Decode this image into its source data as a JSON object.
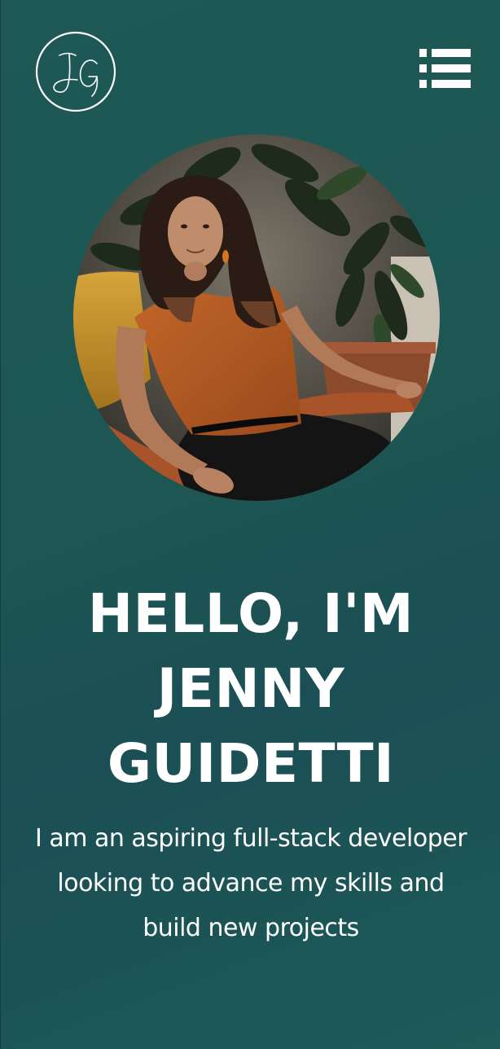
{
  "header": {
    "logo_text": "JG",
    "logo_icon": "monogram-logo",
    "menu_icon": "list-menu-icon"
  },
  "hero": {
    "photo_alt": "profile-photo",
    "heading_lines": [
      "HELLO, I'M",
      "JENNY",
      "GUIDETTI"
    ],
    "tagline": "I am an aspiring full-stack developer looking to advance my skills and build new projects"
  },
  "colors": {
    "background": "#1e5956",
    "text": "#ffffff",
    "shirt": "#b45a23",
    "chair": "#c7952b"
  }
}
